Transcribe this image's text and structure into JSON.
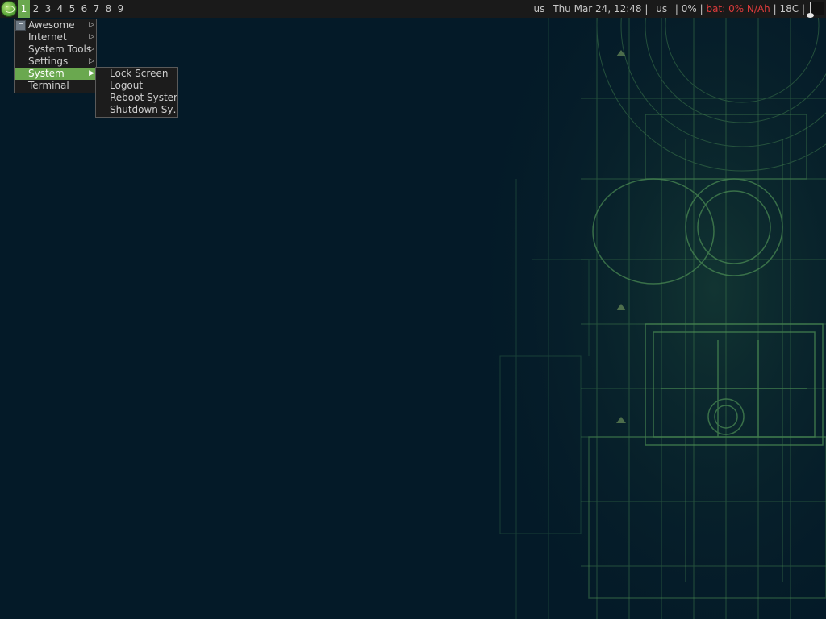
{
  "topbar": {
    "tags": [
      "1",
      "2",
      "3",
      "4",
      "5",
      "6",
      "7",
      "8",
      "9"
    ],
    "active_tag_index": 0,
    "keyboard_layout": "us",
    "datetime": "Thu Mar 24, 12:48",
    "keyboard_layout_2": "us",
    "volume": "0%",
    "battery": "bat: 0% N/Ah",
    "temperature": "18C",
    "separator": "|"
  },
  "main_menu": {
    "items": [
      {
        "label": "Awesome",
        "has_submenu": true
      },
      {
        "label": "Internet",
        "has_submenu": true
      },
      {
        "label": "System Tools",
        "has_submenu": true
      },
      {
        "label": "Settings",
        "has_submenu": true
      },
      {
        "label": "System",
        "has_submenu": true,
        "selected": true
      },
      {
        "label": "Terminal",
        "has_submenu": false
      }
    ]
  },
  "system_submenu": {
    "items": [
      {
        "label": "Lock Screen"
      },
      {
        "label": "Logout"
      },
      {
        "label": "Reboot System"
      },
      {
        "label": "Shutdown Sy…"
      }
    ]
  },
  "colors": {
    "accent": "#6aa84f",
    "bar_bg": "#1a1a1a",
    "desktop_bg": "#041a28",
    "warning": "#e03c3c"
  }
}
